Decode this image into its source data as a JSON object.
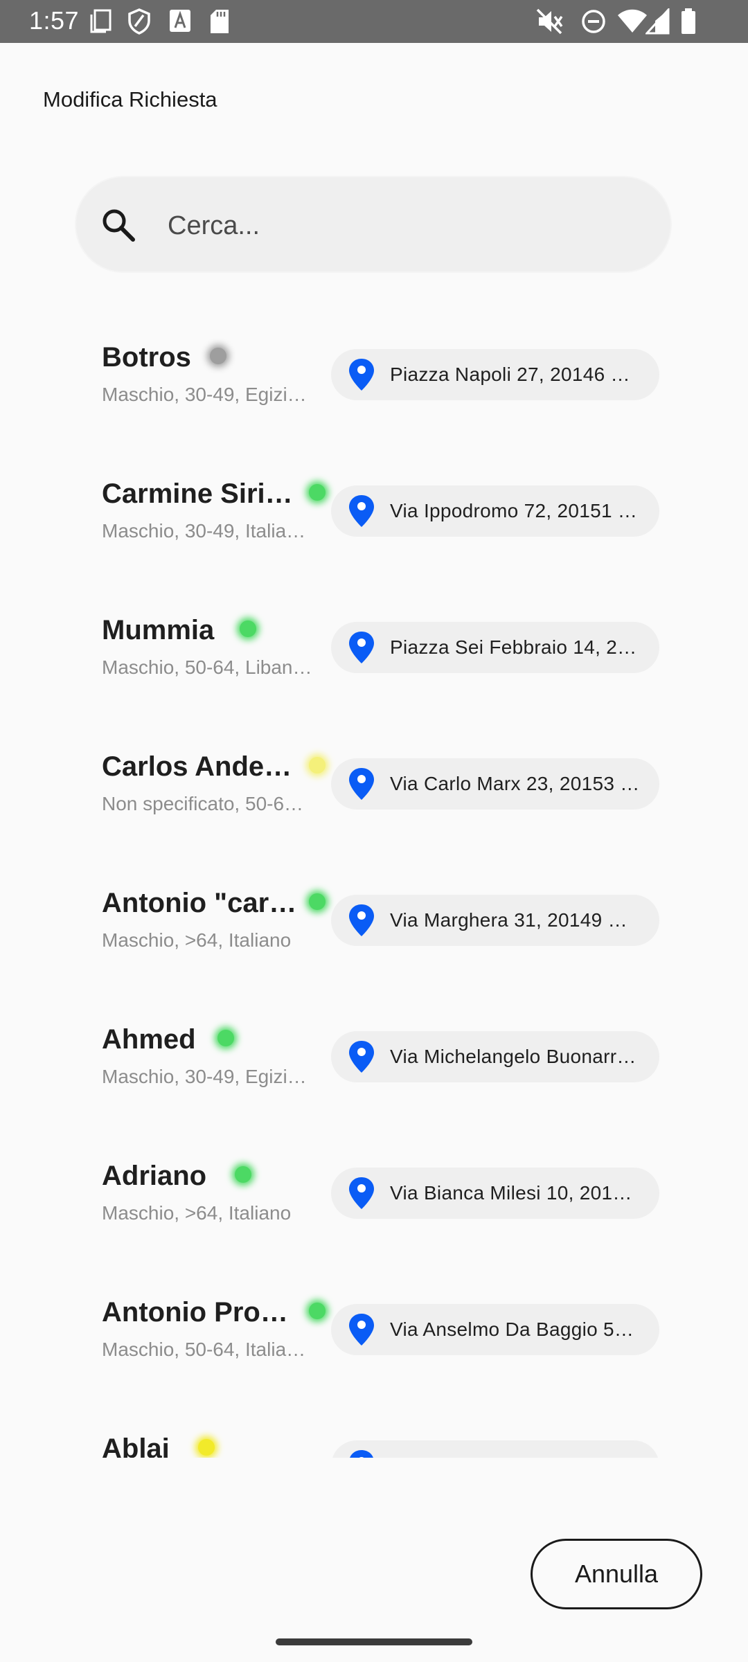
{
  "status_bar": {
    "time": "1:57",
    "icons": [
      "screenshot-icon",
      "shield-icon",
      "a-icon",
      "sd-card-icon",
      "mute-icon",
      "dnd-icon",
      "wifi-icon",
      "signal-icon",
      "battery-icon"
    ]
  },
  "header": {
    "title": "Modifica Richiesta"
  },
  "search": {
    "placeholder": "Cerca..."
  },
  "people": [
    {
      "name": "Botros",
      "details": "Maschio, 30-49,  Egizi…",
      "address": "Piazza Napoli 27, 20146 …",
      "status_color": "#9e9e9e"
    },
    {
      "name": "Carmine Siri…",
      "details": "Maschio, 30-49,  Italia…",
      "address": "Via Ippodromo 72, 20151 …",
      "status_color": "#4cd964"
    },
    {
      "name": "Mummia",
      "details": "Maschio, 50-64,  Liban…",
      "address": "Piazza Sei Febbraio 14, 2…",
      "status_color": "#4cd964"
    },
    {
      "name": "Carlos Ande…",
      "details": "Non specificato, 50-6…",
      "address": "Via Carlo Marx 23, 20153 …",
      "status_color": "#f4f07a"
    },
    {
      "name": "Antonio \"car…",
      "details": "Maschio, >64,  Italiano",
      "address": "Via Marghera 31, 20149 …",
      "status_color": "#4cd964"
    },
    {
      "name": "Ahmed",
      "details": "Maschio, 30-49,  Egizi…",
      "address": "Via Michelangelo Buonarr…",
      "status_color": "#4cd964"
    },
    {
      "name": "Adriano",
      "details": "Maschio, >64,  Italiano",
      "address": "Via Bianca Milesi 10, 201…",
      "status_color": "#4cd964"
    },
    {
      "name": "Antonio Pro…",
      "details": "Maschio, 50-64,  Italia…",
      "address": "Via Anselmo Da Baggio 5…",
      "status_color": "#4cd964"
    },
    {
      "name": "Ablai",
      "details": "",
      "address": "",
      "status_color": "#f2ea2a"
    }
  ],
  "actions": {
    "cancel_label": "Annulla"
  },
  "colors": {
    "pin": "#0a5cf5",
    "accent": "#1a1a1a"
  }
}
